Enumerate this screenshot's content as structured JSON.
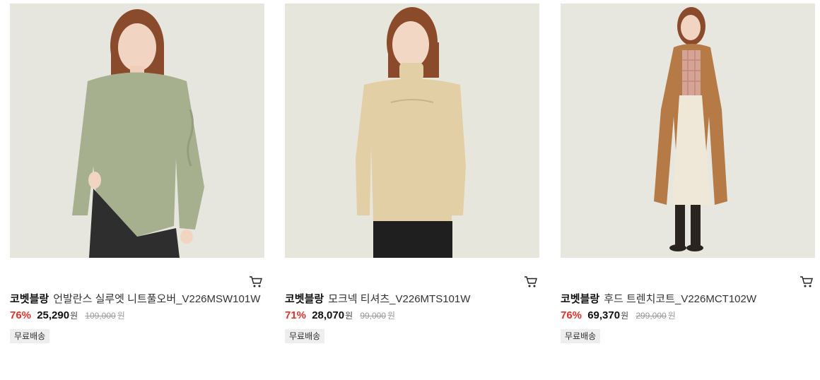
{
  "products": [
    {
      "brand": "코벳블랑",
      "name": "언발란스 실루엣 니트풀오버_V226MSW101W",
      "discount": "76%",
      "sale_price": "25,290",
      "won": "원",
      "original_price": "109,000",
      "badge": "무료배송",
      "cart_icon": "cart-icon",
      "image": {
        "bg": "#e6e6df",
        "garment": "#a6b08f",
        "bottom": "#2e2e2e",
        "hair": "#8a4a2c"
      }
    },
    {
      "brand": "코벳블랑",
      "name": "모크넥 티셔츠_V226MTS101W",
      "discount": "71%",
      "sale_price": "28,070",
      "won": "원",
      "original_price": "99,000",
      "badge": "무료배송",
      "cart_icon": "cart-icon",
      "image": {
        "bg": "#e7e6dd",
        "garment": "#e3cfa5",
        "bottom": "#1f1f1f",
        "hair": "#8b4a2a"
      }
    },
    {
      "brand": "코벳블랑",
      "name": "후드 트렌치코트_V226MCT102W",
      "discount": "76%",
      "sale_price": "69,370",
      "won": "원",
      "original_price": "299,000",
      "badge": "무료배송",
      "cart_icon": "cart-icon",
      "image": {
        "bg": "#e8e7df",
        "garment": "#b57a45",
        "bottom": "#efe8d8",
        "hair": "#8a4a2c"
      }
    }
  ]
}
